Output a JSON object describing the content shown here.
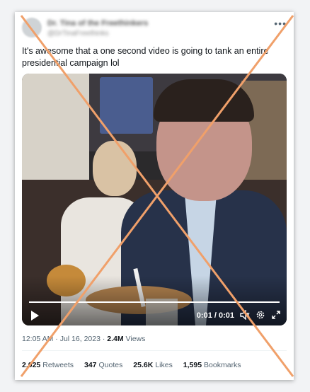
{
  "tweet": {
    "author_name": "Dr. Tina of the Freethinkers",
    "author_handle": "@DrTinaFreethinks",
    "more_icon": "more-horizontal-icon",
    "text": "It's awesome that a one second video is going to tank an entire\npresidential campaign lol",
    "video": {
      "time": "0:01 / 0:01",
      "progress": 1.0,
      "play_icon": "play-icon",
      "volume_icon": "volume-icon",
      "settings_icon": "gear-icon",
      "fullscreen_icon": "fullscreen-icon"
    },
    "meta": {
      "time": "12:05 AM",
      "separator": "·",
      "date": "Jul 16, 2023",
      "views_count": "2.4M",
      "views_label": "Views"
    },
    "stats": [
      {
        "count": "2,025",
        "label": "Retweets"
      },
      {
        "count": "347",
        "label": "Quotes"
      },
      {
        "count": "25.6K",
        "label": "Likes"
      },
      {
        "count": "1,595",
        "label": "Bookmarks"
      }
    ]
  },
  "overlay": {
    "mark": "cross-out",
    "color": "#f0a06a"
  }
}
